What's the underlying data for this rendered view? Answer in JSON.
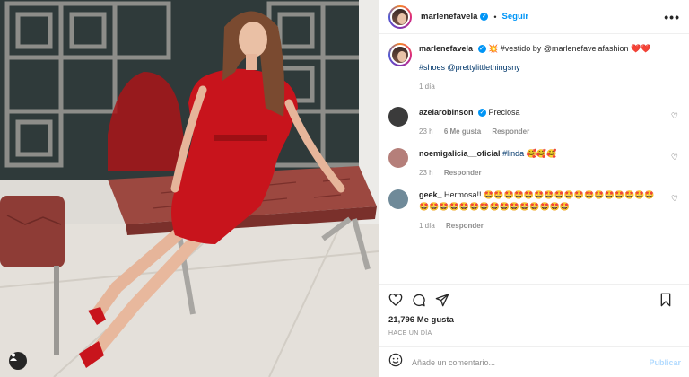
{
  "post": {
    "author": "marlenefavela",
    "follow_label": "Seguir",
    "more_label": "•••",
    "dot": "•"
  },
  "caption": {
    "author": "marlenefavela",
    "text": "💥 #vestido by @marlenefavelafashion ❤️❤️",
    "text2": "#shoes @prettylittlethingsny",
    "time": "1 día"
  },
  "comments": [
    {
      "user": "azelarobinson",
      "verified": true,
      "text": "Preciosa",
      "time": "23 h",
      "likes": "6 Me gusta",
      "reply": "Responder",
      "avatar_color": "#3b3b3b"
    },
    {
      "user": "noemigalicia__oficial",
      "verified": false,
      "text": "#linda 🥰🥰🥰",
      "time": "23 h",
      "likes": "",
      "reply": "Responder",
      "avatar_color": "#b57f7a"
    },
    {
      "user": "geek_",
      "verified": false,
      "text": "Hermosa!! 🤩🤩🤩🤩🤩🤩🤩🤩🤩🤩🤩🤩🤩🤩🤩🤩🤩🤩🤩🤩🤩🤩🤩🤩🤩🤩🤩🤩🤩🤩🤩🤩",
      "time": "1 día",
      "likes": "",
      "reply": "Responder",
      "avatar_color": "#6f8a99"
    }
  ],
  "actions": {
    "likes": "21,796 Me gusta",
    "ago": "HACE UN DÍA"
  },
  "composer": {
    "placeholder": "Añade un comentario...",
    "publish": "Publicar"
  },
  "icons": [
    "heart-icon",
    "comment-icon",
    "share-icon",
    "bookmark-icon",
    "emoji-icon",
    "tag-user-icon"
  ],
  "colors": {
    "accent": "#0095f6",
    "dress": "#c8141c",
    "hash": "#00376b"
  }
}
